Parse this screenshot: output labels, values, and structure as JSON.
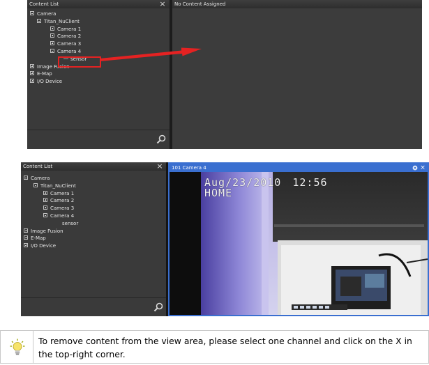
{
  "top_screenshot": {
    "content_list": {
      "title": "Content List",
      "close_glyph": "×",
      "tree": [
        {
          "label": "Camera"
        },
        {
          "label": "Titan_NuClient"
        },
        {
          "label": "Camera 1"
        },
        {
          "label": "Camera 2"
        },
        {
          "label": "Camera 3"
        },
        {
          "label": "Camera 4"
        },
        {
          "label": "sensor"
        },
        {
          "label": "Image Fusion"
        },
        {
          "label": "E-Map"
        },
        {
          "label": "I/O Device"
        }
      ]
    },
    "view": {
      "title": "No Content Assigned"
    },
    "annotation": {
      "color": "#e52222",
      "icon": "arrow-right-icon"
    }
  },
  "bottom_screenshot": {
    "content_list": {
      "title": "Content List",
      "close_glyph": "×",
      "tree": [
        {
          "label": "Camera"
        },
        {
          "label": "Titan_NuClient"
        },
        {
          "label": "Camera 1"
        },
        {
          "label": "Camera 2"
        },
        {
          "label": "Camera 3"
        },
        {
          "label": "Camera 4"
        },
        {
          "label": "sensor"
        },
        {
          "label": "Image Fusion"
        },
        {
          "label": "E-Map"
        },
        {
          "label": "I/O Device"
        }
      ]
    },
    "view": {
      "title": "101 Camera 4",
      "selected_color": "#3a6fd0",
      "osd_date": "Aug/23/2010",
      "osd_time": "12:56",
      "osd_label": "HOME",
      "header_icons": [
        "settings-icon",
        "close-icon"
      ],
      "close_glyph": "×"
    }
  },
  "tip": {
    "icon": "lightbulb-icon",
    "text": "To remove content from the view area, please select one channel and click on the X in the top-right corner."
  }
}
